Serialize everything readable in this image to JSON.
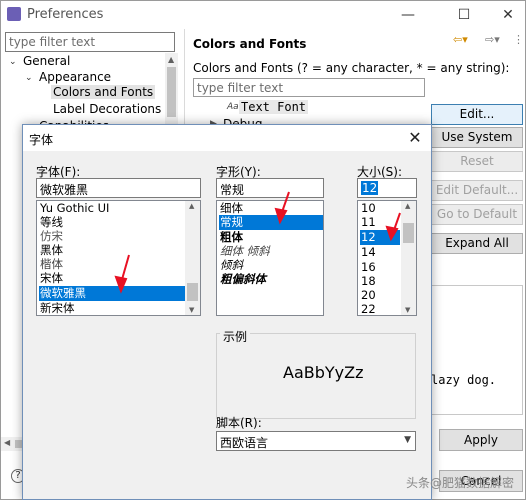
{
  "prefs": {
    "window_title": "Preferences",
    "filter_placeholder": "type filter text",
    "tree": [
      {
        "label": "General",
        "twisty": "⌄"
      },
      {
        "label": "Appearance",
        "twisty": "⌄"
      },
      {
        "label": "Colors and Fonts",
        "twisty": ""
      },
      {
        "label": "Label Decorations",
        "twisty": ""
      },
      {
        "label": "Capabilities",
        "twisty": ""
      }
    ],
    "page_title": "Colors and Fonts",
    "description": "Colors and Fonts (? = any character, * = any string):",
    "inner_filter_placeholder": "type filter text",
    "text_font_label": "Text Font",
    "text_font_icon": "Aa",
    "debug_label": "Debug",
    "buttons": {
      "edit": "Edit...",
      "use_system_font": "Use System Font",
      "reset": "Reset",
      "edit_default": "Edit Default...",
      "go_to_default": "Go to Default",
      "expand_all": "Expand All"
    },
    "preview_text": "lazy dog.",
    "apply": "Apply",
    "cancel": "Cancel",
    "help": "?"
  },
  "font_dialog": {
    "title": "字体",
    "font_label": "字体(F):",
    "font_value": "微软雅黑",
    "fonts": [
      "Yu Gothic UI",
      "等线",
      "仿宋",
      "黑体",
      "楷体",
      "宋体",
      "微软雅黑",
      "新宋体"
    ],
    "font_selected_index": 6,
    "style_label": "字形(Y):",
    "style_value": "常规",
    "styles": [
      "细体",
      "常规",
      "粗体",
      "细体 倾斜",
      "倾斜",
      "粗偏斜体"
    ],
    "style_selected_index": 1,
    "size_label": "大小(S):",
    "size_value": "12",
    "sizes": [
      "10",
      "11",
      "12",
      "14",
      "16",
      "18",
      "20",
      "22"
    ],
    "size_selected_index": 2,
    "sample_label": "示例",
    "sample_text": "AaBbYyZz",
    "script_label": "脚本(R):",
    "script_value": "西欧语言"
  },
  "watermark": "头条@肥猫数据解密",
  "colors": {
    "selection": "#0078d7",
    "annotation_arrow": "#e81123"
  }
}
